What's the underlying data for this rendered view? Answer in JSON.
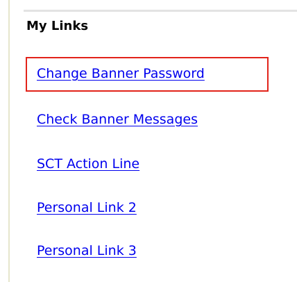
{
  "panel": {
    "title": "My Links",
    "links": [
      {
        "label": "Change Banner Password"
      },
      {
        "label": "Check Banner Messages"
      },
      {
        "label": "SCT Action Line"
      },
      {
        "label": "Personal Link 2"
      },
      {
        "label": "Personal Link 3"
      }
    ],
    "highlighted_link_index": 0
  },
  "colors": {
    "link": "#0000ee",
    "highlight_border": "#e2231a",
    "title": "#000000"
  }
}
